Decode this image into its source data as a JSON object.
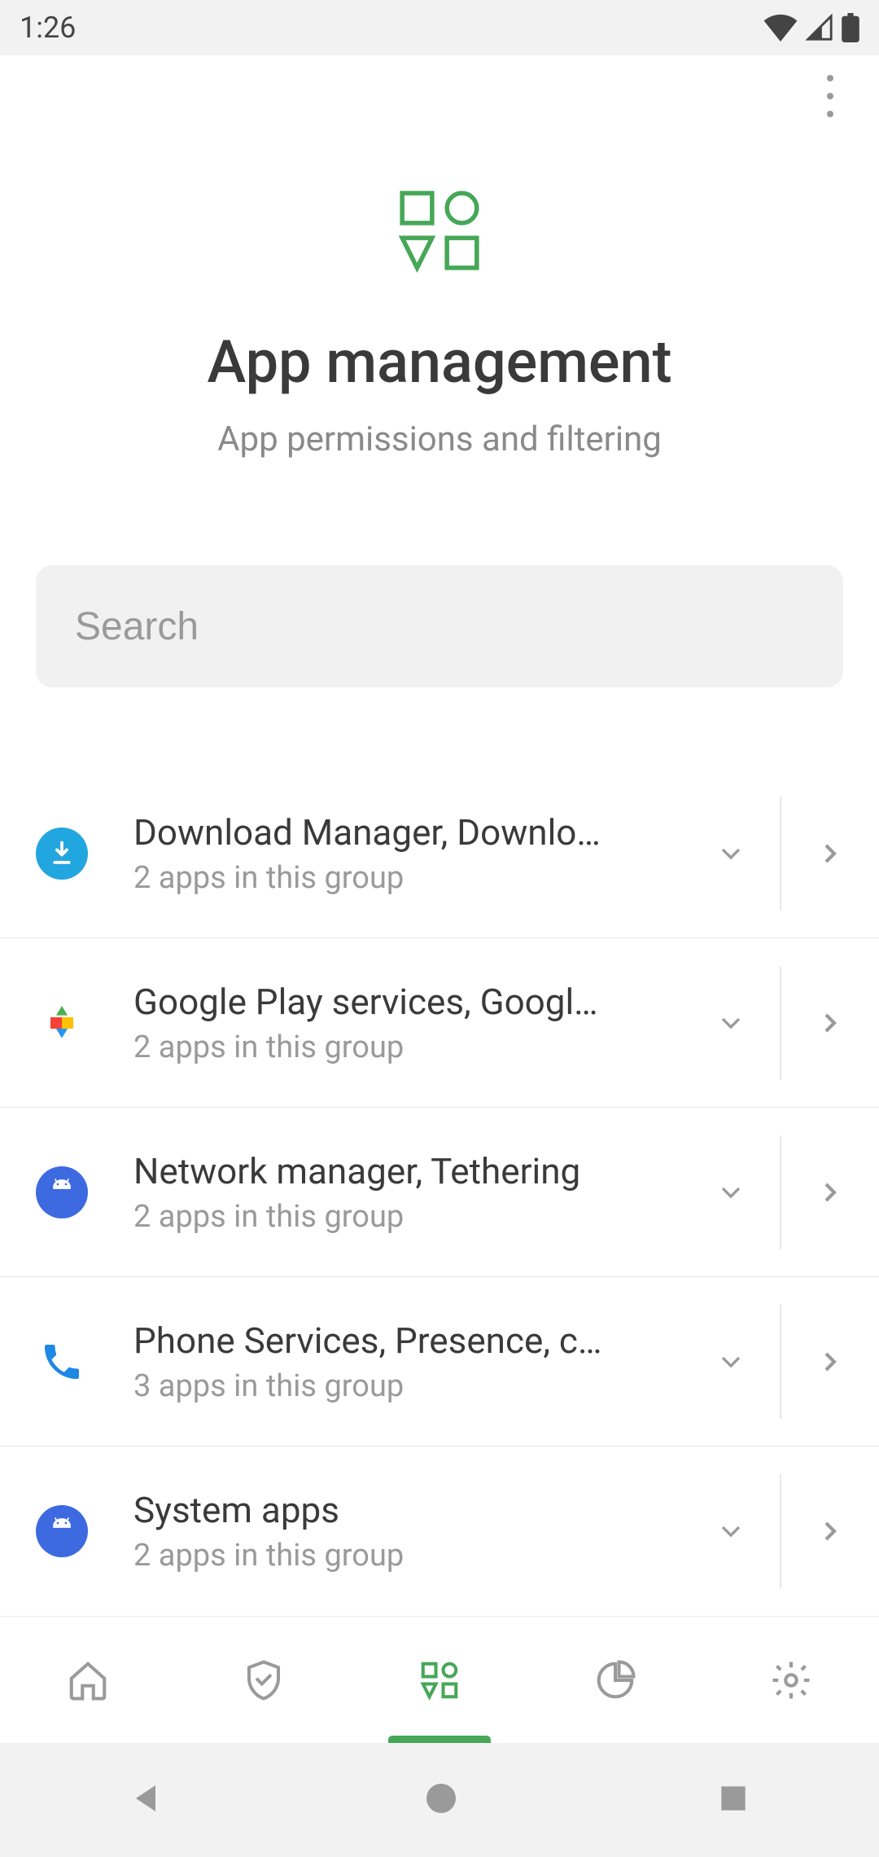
{
  "status": {
    "time": "1:26"
  },
  "header": {
    "title": "App management",
    "subtitle": "App permissions and filtering"
  },
  "search": {
    "placeholder": "Search",
    "value": ""
  },
  "groups": [
    {
      "title": "Download Manager, Downlo…",
      "subtitle": "2 apps in this group",
      "icon": "download"
    },
    {
      "title": "Google Play services, Googl…",
      "subtitle": "2 apps in this group",
      "icon": "play-services"
    },
    {
      "title": "Network manager, Tethering",
      "subtitle": "2 apps in this group",
      "icon": "android"
    },
    {
      "title": "Phone Services, Presence, c…",
      "subtitle": "3 apps in this group",
      "icon": "phone"
    },
    {
      "title": "System apps",
      "subtitle": "2 apps in this group",
      "icon": "android"
    }
  ],
  "tabs": {
    "items": [
      "home",
      "protection",
      "apps",
      "stats",
      "settings"
    ],
    "active_index": 2
  },
  "accent": "#46a756"
}
